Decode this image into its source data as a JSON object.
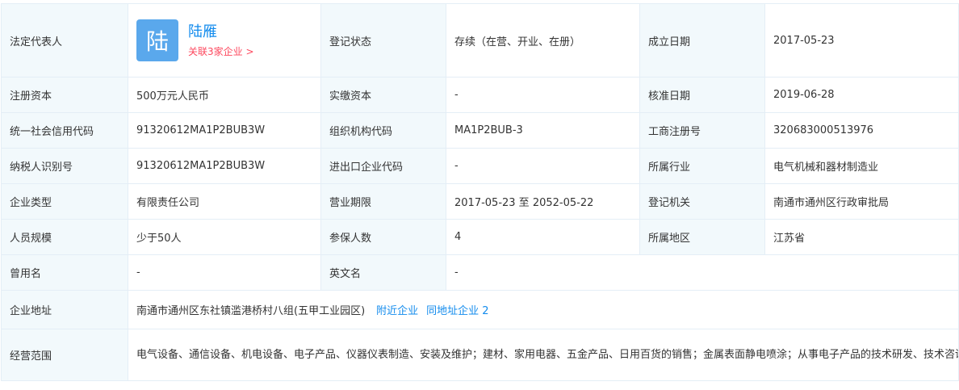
{
  "rows": {
    "legal_rep": {
      "label": "法定代表人",
      "avatar_char": "陆",
      "name": "陆雁",
      "related_link": "关联3家企业 >",
      "status_label": "登记状态",
      "status_value": "存续（在营、开业、在册）",
      "founded_label": "成立日期",
      "founded_value": "2017-05-23"
    },
    "capital": {
      "registered_label": "注册资本",
      "registered_value": "500万元人民币",
      "paid_label": "实缴资本",
      "paid_value": "-",
      "approved_label": "核准日期",
      "approved_value": "2019-06-28"
    },
    "codes": {
      "credit_label": "统一社会信用代码",
      "credit_value": "91320612MA1P2BUB3W",
      "org_label": "组织机构代码",
      "org_value": "MA1P2BUB-3",
      "reg_no_label": "工商注册号",
      "reg_no_value": "320683000513976"
    },
    "tax": {
      "taxid_label": "纳税人识别号",
      "taxid_value": "91320612MA1P2BUB3W",
      "import_label": "进出口企业代码",
      "import_value": "-",
      "industry_label": "所属行业",
      "industry_value": "电气机械和器材制造业"
    },
    "type": {
      "type_label": "企业类型",
      "type_value": "有限责任公司",
      "term_label": "营业期限",
      "term_value": "2017-05-23 至 2052-05-22",
      "authority_label": "登记机关",
      "authority_value": "南通市通州区行政审批局"
    },
    "staff": {
      "size_label": "人员规模",
      "size_value": "少于50人",
      "insured_label": "参保人数",
      "insured_value": "4",
      "region_label": "所属地区",
      "region_value": "江苏省"
    },
    "names": {
      "former_label": "曾用名",
      "former_value": "-",
      "english_label": "英文名",
      "english_value": "-"
    },
    "address": {
      "label": "企业地址",
      "value": "南通市通州区东社镇滥港桥村八组(五甲工业园区)",
      "nearby_link": "附近企业",
      "same_address_link": "同地址企业 2"
    },
    "scope": {
      "label": "经营范围",
      "value": "电气设备、通信设备、机电设备、电子产品、仪器仪表制造、安装及维护；建材、家用电器、五金产品、日用百货的销售；金属表面静电喷涂；从事电子产品的技术研发、技术咨询、技术转让、技术服务。（依法须经批准的项目，经相关部门批准后方可开展经营活动）"
    }
  },
  "colors": {
    "label_bg": "#f2f9fc",
    "border": "#e4eef6",
    "link_blue": "#128bed",
    "related_red": "#fd485e",
    "avatar_bg": "#5aa8ec"
  }
}
